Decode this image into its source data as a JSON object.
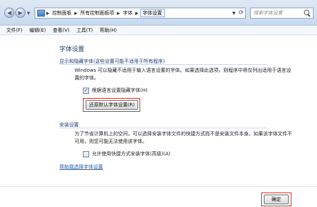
{
  "address_bar": {
    "breadcrumbs": [
      "控制面板",
      "所有控制面板项",
      "字体",
      "字体设置"
    ]
  },
  "search": {
    "placeholder": "搜索字体设置"
  },
  "menu": [
    "文件(F)",
    "编辑(E)",
    "查看(V)",
    "工具(T)",
    "帮助(H)"
  ],
  "page": {
    "title": "字体设置",
    "section1": {
      "title": "显示和隐藏字体(这些设置可能不适用于所有程序)",
      "description_line1": "Windows 可以隐藏不适用于输入语言设置的字体。如果选择此选项，则程序中将仅列出适用于语言设",
      "description_line2": "置的字体。",
      "checkbox_label": "根据语言设置隐藏字体(H)",
      "checkbox_mark": "✓",
      "checkbox_checked": true,
      "restore_button": "还原默认字体设置(R)"
    },
    "section2": {
      "title": "安装设置",
      "description_line1": "为了节省计算机上的空间，可以选择安装字体文件的快捷方式而不是安装文件本身。如果该字体文件不",
      "description_line2": "可用，则您可能无法使用该字体。",
      "checkbox_label": "允许使用快捷方式安装字体(高级)(A)",
      "checkbox_checked": false
    },
    "help_link": "帮助我选择字体设置",
    "ok_button": "确定"
  }
}
